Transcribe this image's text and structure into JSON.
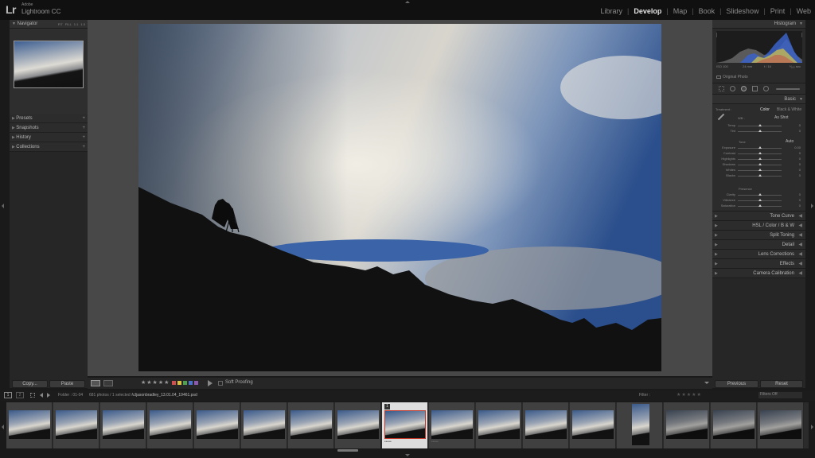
{
  "app": {
    "logo": "Lr",
    "vendor": "Adobe",
    "name": "Lightroom CC"
  },
  "modules": [
    {
      "label": "Library",
      "active": false
    },
    {
      "label": "Develop",
      "active": true
    },
    {
      "label": "Map",
      "active": false
    },
    {
      "label": "Book",
      "active": false
    },
    {
      "label": "Slideshow",
      "active": false
    },
    {
      "label": "Print",
      "active": false
    },
    {
      "label": "Web",
      "active": false
    }
  ],
  "left_panel": {
    "navigator": {
      "title": "Navigator",
      "zoom_options": [
        "FIT",
        "FILL",
        "1:1",
        "1:3"
      ]
    },
    "sections": [
      {
        "label": "Presets"
      },
      {
        "label": "Snapshots"
      },
      {
        "label": "History"
      },
      {
        "label": "Collections"
      }
    ],
    "copy_label": "Copy...",
    "paste_label": "Paste"
  },
  "right_panel": {
    "histogram": {
      "title": "Histogram",
      "iso": "ISO 100",
      "focal": "24 mm",
      "aperture": "f / 16",
      "shutter": "¹⁄₁₆₀ sec",
      "original_photo": "Original Photo"
    },
    "basic": {
      "title": "Basic",
      "treatment_label": "Treatment :",
      "color_label": "Color",
      "bw_label": "Black & White",
      "wb_label": "WB :",
      "wb_value": "As Shot",
      "tone_label": "Tone",
      "auto_label": "Auto",
      "presence_label": "Presence",
      "sliders_wb": [
        {
          "label": "Temp",
          "value": "0",
          "pos": 0.5
        },
        {
          "label": "Tint",
          "value": "0",
          "pos": 0.5
        }
      ],
      "sliders_tone": [
        {
          "label": "Exposure",
          "value": "0.00",
          "pos": 0.5
        },
        {
          "label": "Contrast",
          "value": "0",
          "pos": 0.5
        },
        {
          "label": "Highlights",
          "value": "0",
          "pos": 0.5
        },
        {
          "label": "Shadows",
          "value": "0",
          "pos": 0.5
        },
        {
          "label": "Whites",
          "value": "0",
          "pos": 0.5
        },
        {
          "label": "Blacks",
          "value": "0",
          "pos": 0.5
        }
      ],
      "sliders_presence": [
        {
          "label": "Clarity",
          "value": "0",
          "pos": 0.5
        },
        {
          "label": "Vibrance",
          "value": "0",
          "pos": 0.5
        },
        {
          "label": "Saturation",
          "value": "0",
          "pos": 0.5
        }
      ]
    },
    "sections": [
      {
        "label": "Tone Curve"
      },
      {
        "label": "HSL / Color / B & W"
      },
      {
        "label": "Split Toning"
      },
      {
        "label": "Detail"
      },
      {
        "label": "Lens Corrections"
      },
      {
        "label": "Effects"
      },
      {
        "label": "Camera Calibration"
      }
    ],
    "previous_label": "Previous",
    "reset_label": "Reset"
  },
  "toolbar": {
    "stars": "★★★★★",
    "soft_proofing": "Soft Proofing",
    "color_labels": [
      "#d05050",
      "#d8c040",
      "#50a050",
      "#4a70c8",
      "#8a5ab0"
    ]
  },
  "filmstrip_header": {
    "page1": "1",
    "page2": "2",
    "folder": "Folder : 01-04",
    "count": "681 photos / 1 selected /",
    "filename": "\\cljasonbradley_13.01.04_19461.psd",
    "filter_label": "Filter :",
    "filters_off": "Filters Off",
    "selected_index": "1"
  },
  "filmstrip": {
    "count": 17,
    "selected": 8
  }
}
